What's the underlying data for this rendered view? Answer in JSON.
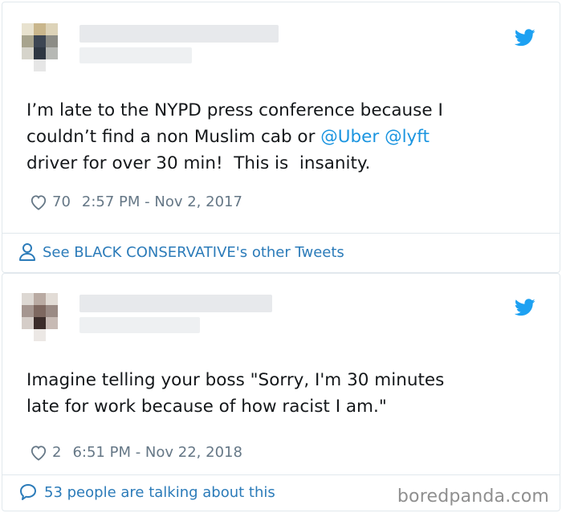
{
  "tweets": [
    {
      "text_before": "I’m late to the NYPD press conference because I\ncouldn’t find a non Muslim cab or ",
      "mention1": "@Uber",
      "text_mid": " ",
      "mention2": "@lyft",
      "text_after": "\ndriver for over 30 min!  This is  insanity.",
      "likes": "70",
      "timestamp": "2:57 PM - Nov 2, 2017",
      "footer_text": "See BLACK CONSERVATIVE's other Tweets",
      "footer_icon": "person-icon"
    },
    {
      "text": "Imagine telling your boss \"Sorry, I'm 30 minutes\nlate for work because of how racist I am.\"",
      "likes": "2",
      "timestamp": "6:51 PM - Nov 22, 2018",
      "footer_text": "53 people are talking about this",
      "footer_icon": "speech-bubble-icon"
    }
  ],
  "watermark": "boredpanda.com",
  "colors": {
    "accent": "#1da1f2",
    "link": "#2b7bb9",
    "muted": "#657786",
    "border": "#e1e8ed"
  }
}
